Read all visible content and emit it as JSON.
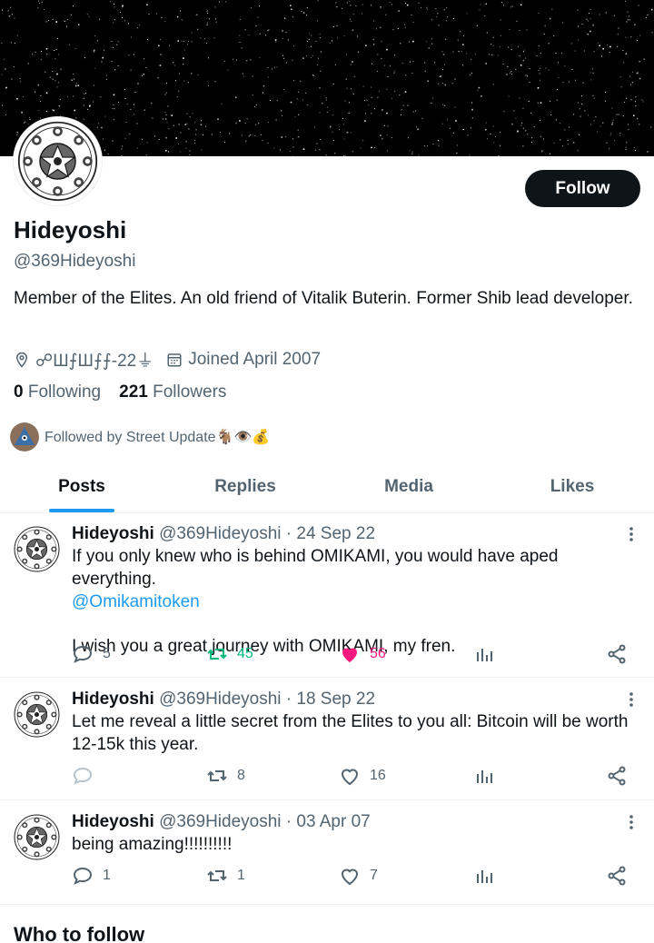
{
  "profile": {
    "display_name": "Hideyoshi",
    "handle": "@369Hideyoshi",
    "bio": "Member of the Elites. An old friend of Vitalik Buterin.  Former Shib lead developer.",
    "location": "☍Ш⨍Ш⨍⨍-22⏚",
    "joined": "Joined April 2007",
    "following_count": "0",
    "following_label": "Following",
    "followers_count": "221",
    "followers_label": "Followers",
    "followed_by": "Followed by Street Update🐐👁️💰",
    "follow_button": "Follow"
  },
  "tabs": [
    {
      "label": "Posts",
      "active": true
    },
    {
      "label": "Replies",
      "active": false
    },
    {
      "label": "Media",
      "active": false
    },
    {
      "label": "Likes",
      "active": false
    }
  ],
  "tweets": [
    {
      "name": "Hideyoshi",
      "meta": "@369Hideyoshi · 24 Sep 22",
      "line1": "If you only knew who is behind OMIKAMI, you would have aped everything.",
      "link": "@Omikamitoken",
      "line2": "I wish you a great journey with OMIKAMI, my fren.",
      "replies": "5",
      "retweets": "45",
      "likes": "56",
      "liked": true,
      "retweeted": true
    },
    {
      "name": "Hideyoshi",
      "meta": "@369Hideyoshi · 18 Sep 22",
      "line1": "Let me reveal a little secret from the Elites to you all: Bitcoin will be worth 12-15k this year.",
      "replies": "",
      "retweets": "8",
      "likes": "16"
    },
    {
      "name": "Hideyoshi",
      "meta": "@369Hideyoshi · 03 Apr 07",
      "line1": "being amazing!!!!!!!!!!",
      "replies": "1",
      "retweets": "1",
      "likes": "7"
    }
  ],
  "who_to_follow": "Who to follow",
  "icons": {
    "location": "location-pin-icon",
    "calendar": "calendar-icon",
    "reply": "reply-icon",
    "retweet": "retweet-icon",
    "like": "heart-icon",
    "views": "views-chart-icon",
    "share": "share-icon",
    "more": "more-dots-icon"
  },
  "colors": {
    "accent": "#1d9bf0",
    "retweet_active": "#00ba7c",
    "like_active": "#f91880",
    "secondary_text": "#536471",
    "button_bg": "#0f1419"
  }
}
